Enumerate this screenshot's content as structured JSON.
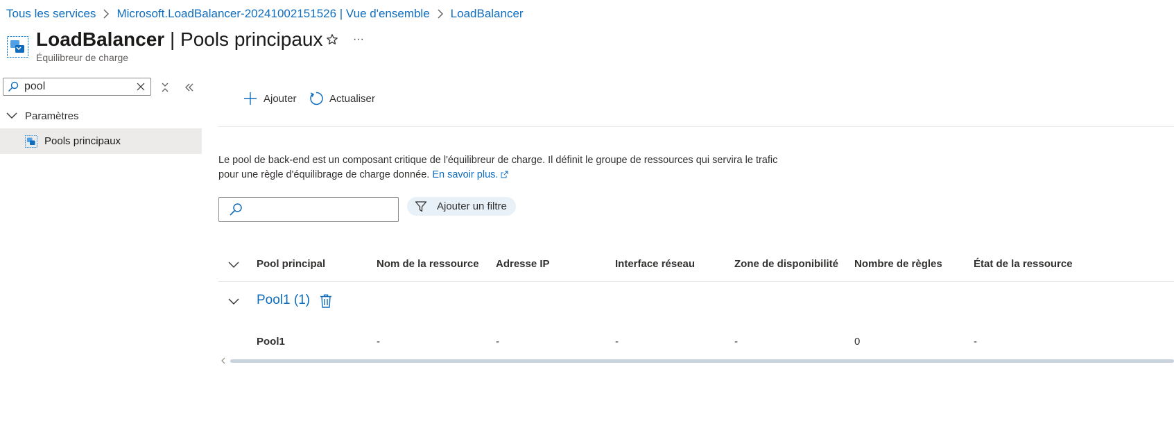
{
  "breadcrumb": {
    "items": [
      {
        "label": "Tous les services"
      },
      {
        "label": "Microsoft.LoadBalancer-20241002151526 | Vue d'ensemble"
      },
      {
        "label": "LoadBalancer"
      }
    ]
  },
  "header": {
    "resource_name": "LoadBalancer",
    "separator": "|",
    "page_name": "Pools principaux",
    "subtitle": "Équilibreur de charge",
    "more_label": "···"
  },
  "nav": {
    "search_value": "pool",
    "group_label": "Paramètres",
    "items": [
      {
        "label": "Pools principaux",
        "selected": true
      }
    ]
  },
  "commands": {
    "add_label": "Ajouter",
    "refresh_label": "Actualiser"
  },
  "description": {
    "text": "Le pool de back-end est un composant critique de l'équilibreur de charge. Il définit le groupe de ressources qui servira le trafic pour une règle d'équilibrage de charge donnée.",
    "link_label": "En savoir plus."
  },
  "filter": {
    "search_value": "",
    "add_filter_label": "Ajouter un filtre"
  },
  "table": {
    "columns": [
      "Pool principal",
      "Nom de la ressource",
      "Adresse IP",
      "Interface réseau",
      "Zone de disponibilité",
      "Nombre de règles",
      "État de la ressource"
    ],
    "groups": [
      {
        "label": "Pool1 (1)",
        "rows": [
          [
            "Pool1",
            "-",
            "-",
            "-",
            "-",
            "0",
            "-"
          ]
        ]
      }
    ]
  },
  "colors": {
    "link": "#0f6cbd",
    "selected_nav_bg": "#edebe9",
    "filter_pill_bg": "#e8f0f8",
    "text": "#323130"
  },
  "icons": {
    "breadcrumb_separator": "chevron-right-icon",
    "resource": "load-balancer-icon",
    "favorite": "star-icon",
    "more": "ellipsis-icon",
    "nav_search": "search-icon",
    "nav_clear": "close-icon",
    "nav_collapse_all": "collapse-all-icon",
    "nav_hide": "double-chevron-left-icon",
    "group": "chevron-down-icon",
    "add": "plus-icon",
    "refresh": "refresh-icon",
    "external_link": "external-link-icon",
    "filter": "filter-icon",
    "delete": "trash-icon"
  }
}
